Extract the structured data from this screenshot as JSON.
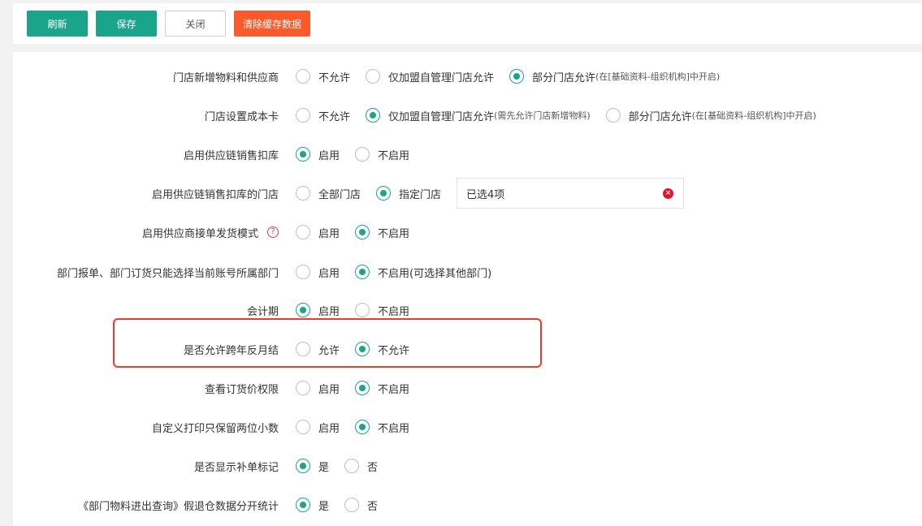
{
  "toolbar": {
    "refresh": "刷新",
    "save": "保存",
    "close": "关闭",
    "clear_cache": "清除缓存数据"
  },
  "settings": [
    {
      "label": "门店新增物料和供应商",
      "options": [
        {
          "text": "不允许",
          "checked": false
        },
        {
          "text": "仅加盟自管理门店允许",
          "checked": false
        },
        {
          "text": "部分门店允许",
          "note": "(在[基础资料-组织机构]中开启)",
          "checked": true
        }
      ]
    },
    {
      "label": "门店设置成本卡",
      "options": [
        {
          "text": "不允许",
          "checked": false
        },
        {
          "text": "仅加盟自管理门店允许",
          "note": "(需先允许门店新增物料)",
          "checked": true
        },
        {
          "text": "部分门店允许",
          "note": "(在[基础资料-组织机构]中开启)",
          "checked": false
        }
      ]
    },
    {
      "label": "启用供应链销售扣库",
      "options": [
        {
          "text": "启用",
          "checked": true
        },
        {
          "text": "不启用",
          "checked": false
        }
      ]
    },
    {
      "label": "启用供应链销售扣库的门店",
      "options": [
        {
          "text": "全部门店",
          "checked": false
        },
        {
          "text": "指定门店",
          "checked": true
        }
      ],
      "selected_text": "已选4项"
    },
    {
      "label": "启用供应商接单发货模式",
      "help": "?",
      "options": [
        {
          "text": "启用",
          "checked": false
        },
        {
          "text": "不启用",
          "checked": true
        }
      ]
    },
    {
      "label": "部门报单、部门订货只能选择当前账号所属部门",
      "options": [
        {
          "text": "启用",
          "checked": false
        },
        {
          "text": "不启用(可选择其他部门)",
          "checked": true
        }
      ]
    },
    {
      "label": "会计期",
      "options": [
        {
          "text": "启用",
          "checked": true
        },
        {
          "text": "不启用",
          "checked": false
        }
      ]
    },
    {
      "label": "是否允许跨年反月结",
      "options": [
        {
          "text": "允许",
          "checked": false
        },
        {
          "text": "不允许",
          "checked": true
        }
      ]
    },
    {
      "label": "查看订货价权限",
      "options": [
        {
          "text": "启用",
          "checked": false
        },
        {
          "text": "不启用",
          "checked": true
        }
      ]
    },
    {
      "label": "自定义打印只保留两位小数",
      "options": [
        {
          "text": "启用",
          "checked": false
        },
        {
          "text": "不启用",
          "checked": true
        }
      ]
    },
    {
      "label": "是否显示补单标记",
      "options": [
        {
          "text": "是",
          "checked": true
        },
        {
          "text": "否",
          "checked": false
        }
      ]
    },
    {
      "label": "《部门物料进出查询》假退仓数据分开统计",
      "options": [
        {
          "text": "是",
          "checked": true
        },
        {
          "text": "否",
          "checked": false
        }
      ]
    }
  ],
  "colors": {
    "accent": "#1aa58a",
    "danger": "#fb5b2c",
    "highlight": "#ef3b2d"
  }
}
